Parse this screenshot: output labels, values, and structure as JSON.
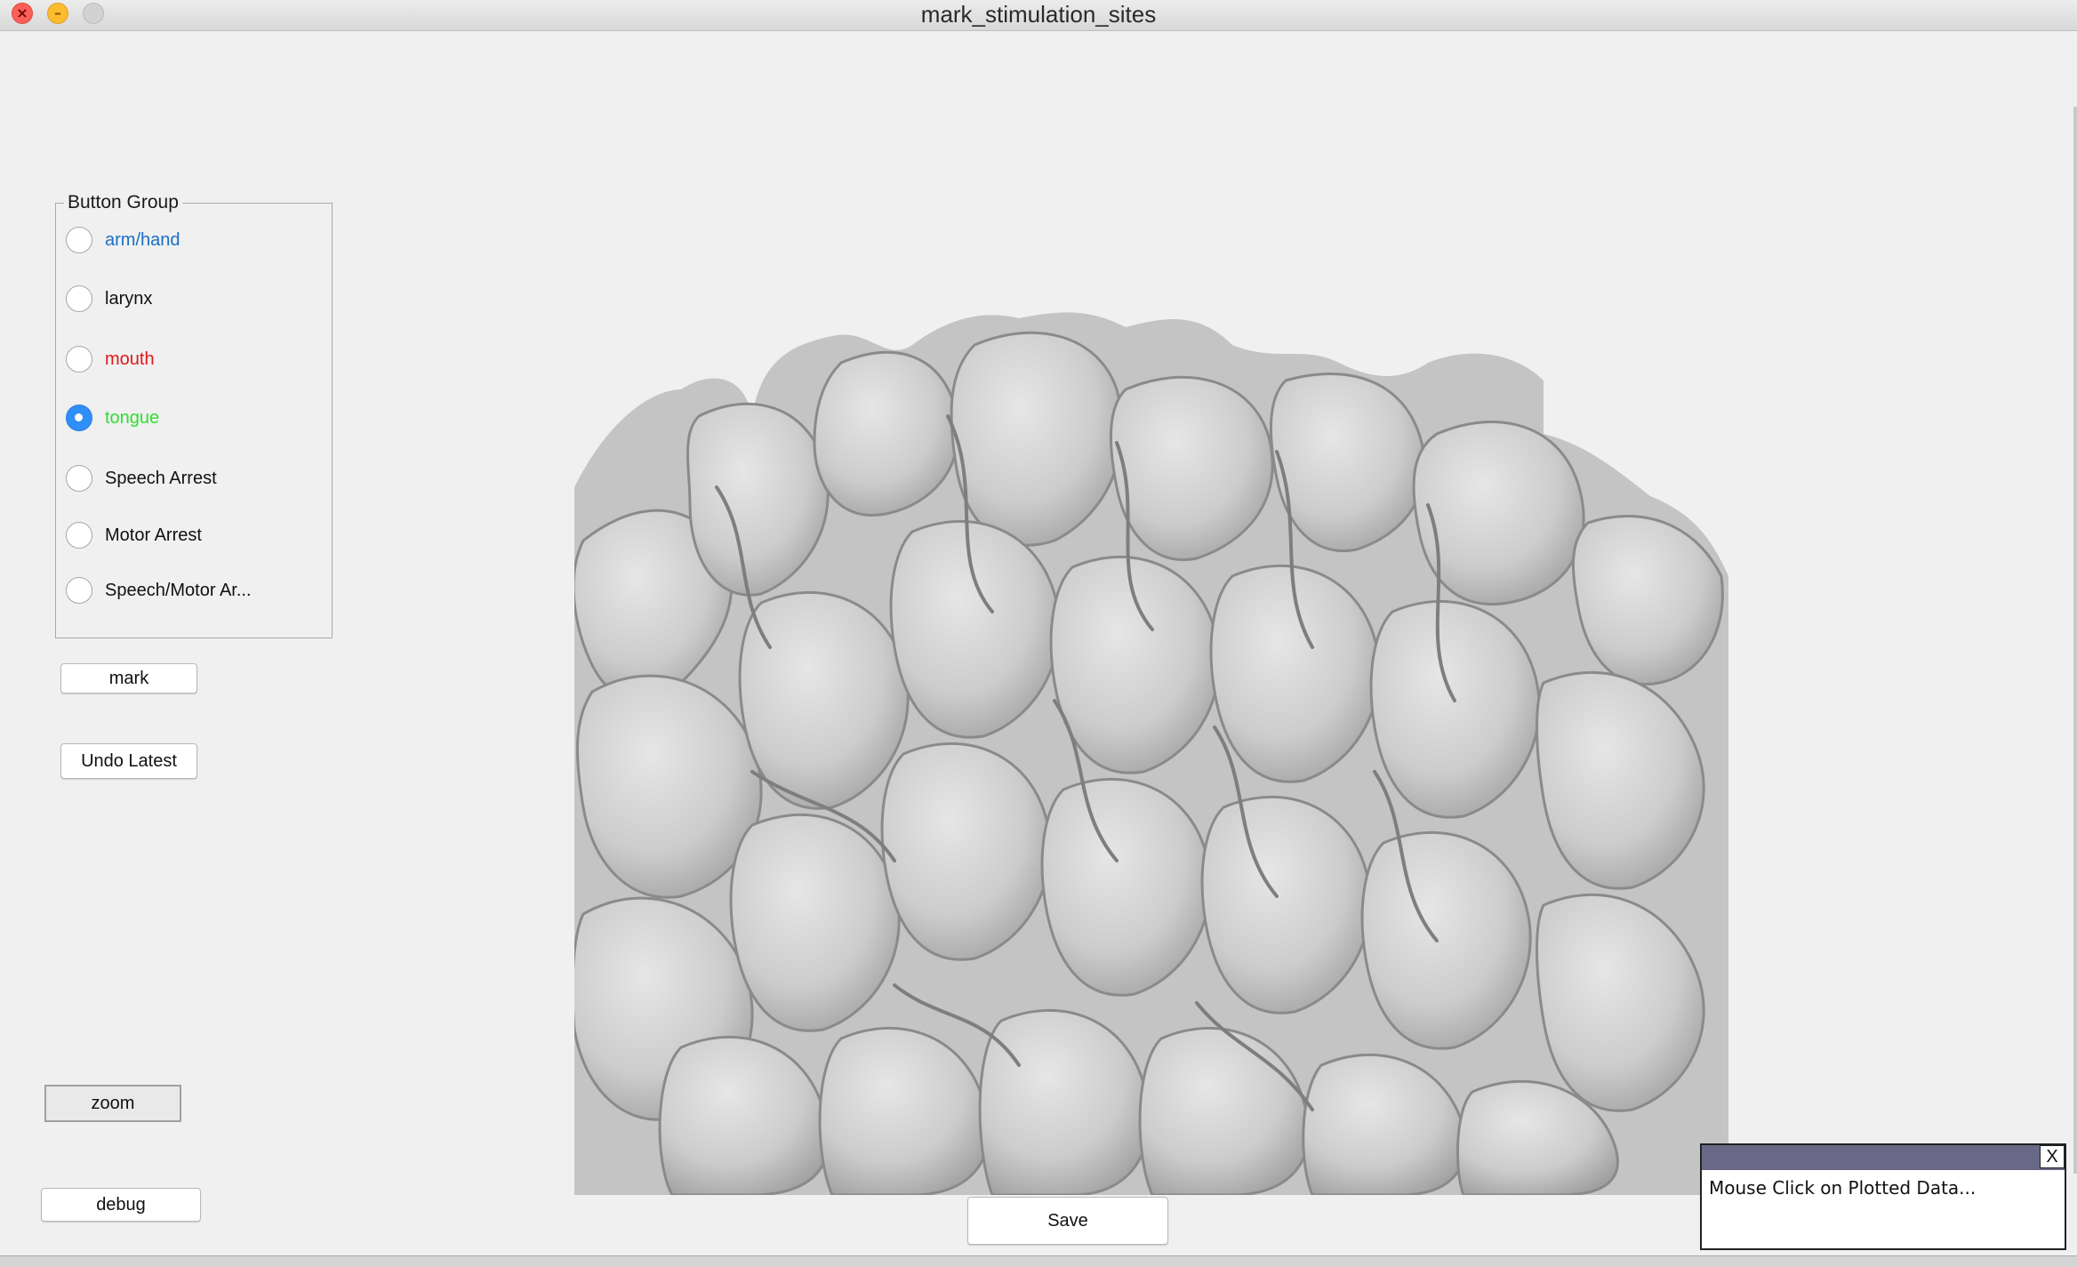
{
  "window": {
    "title": "mark_stimulation_sites"
  },
  "button_group": {
    "title": "Button Group",
    "options": [
      {
        "label": "arm/hand",
        "color": "#1a6fc4",
        "checked": false
      },
      {
        "label": "larynx",
        "color": "#111111",
        "checked": false
      },
      {
        "label": "mouth",
        "color": "#e0161b",
        "checked": false
      },
      {
        "label": "tongue",
        "color": "#2ee02e",
        "checked": true
      },
      {
        "label": "Speech Arrest",
        "color": "#111111",
        "checked": false
      },
      {
        "label": "Motor Arrest",
        "color": "#111111",
        "checked": false
      },
      {
        "label": "Speech/Motor Ar...",
        "color": "#111111",
        "checked": false
      }
    ]
  },
  "buttons": {
    "mark": "mark",
    "undo": "Undo Latest",
    "zoom": "zoom",
    "debug": "debug",
    "save": "Save"
  },
  "popup": {
    "close": "X",
    "message": "Mouse Click on Plotted Data..."
  },
  "colors": {
    "selected_radio": "#2f8ef7",
    "brain_surface": "#c8c8c8",
    "popup_bar": "#696987"
  }
}
